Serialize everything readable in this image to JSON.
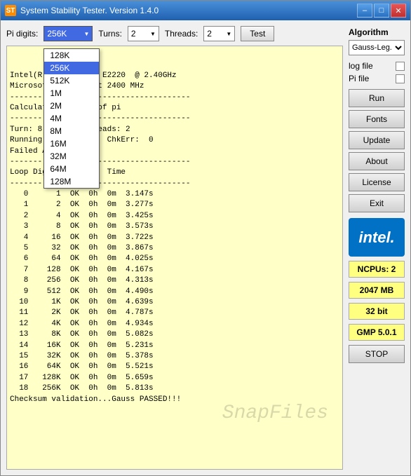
{
  "window": {
    "title": "System Stability Tester. Version 1.4.0",
    "icon": "ST"
  },
  "titleButtons": {
    "minimize": "–",
    "maximize": "□",
    "close": "✕"
  },
  "controls": {
    "piDigitsLabel": "Pi digits:",
    "piDigitsValue": "256K",
    "turnsLabel": "Turns:",
    "turnsValue": "2",
    "threadsLabel": "Threads:",
    "threadsValue": "2",
    "testButton": "Test"
  },
  "dropdown": {
    "options": [
      "128K",
      "256K",
      "512K",
      "1M",
      "2M",
      "4M",
      "8M",
      "16M",
      "32M",
      "64M",
      "128M"
    ],
    "selected": "256K"
  },
  "outputLines": [
    "Intel(R) Dual  CPU  E2220  @ 2.40GHz",
    "Microsoft Windows at 2400 MHz",
    "---------------------------------------",
    "Calculating digits of pi",
    "---------------------------------------",
    "Turn: 8         Threads: 2",
    "Running For: 2.969s  ChkErr:  0",
    "Failed After: 0 yet",
    "---------------------------------------",
    "Loop Digits  Status  Time",
    "---------------------------------------",
    "   0      1  OK  0h  0m  3.147s",
    "   1      2  OK  0h  0m  3.277s",
    "   2      4  OK  0h  0m  3.425s",
    "   3      8  OK  0h  0m  3.573s",
    "   4     16  OK  0h  0m  3.722s",
    "   5     32  OK  0h  0m  3.867s",
    "   6     64  OK  0h  0m  4.025s",
    "   7    128  OK  0h  0m  4.167s",
    "   8    256  OK  0h  0m  4.313s",
    "   9    512  OK  0h  0m  4.490s",
    "  10     1K  OK  0h  0m  4.639s",
    "  11     2K  OK  0h  0m  4.787s",
    "  12     4K  OK  0h  0m  4.934s",
    "  13     8K  OK  0h  0m  5.082s",
    "  14    16K  OK  0h  0m  5.231s",
    "  15    32K  OK  0h  0m  5.378s",
    "  16    64K  OK  0h  0m  5.521s",
    "  17   128K  OK  0h  0m  5.659s",
    "  18   256K  OK  0h  0m  5.813s",
    "Checksum validation...Gauss PASSED!!!"
  ],
  "sidebar": {
    "algorithmLabel": "Algorithm",
    "algorithmValue": "Gauss-Leg.",
    "logFileLabel": "log file",
    "piFileLabel": "Pi file",
    "buttons": {
      "run": "Run",
      "fonts": "Fonts",
      "update": "Update",
      "about": "About",
      "license": "License",
      "exit": "Exit",
      "stop": "STOP"
    },
    "intelText": "intel.",
    "badges": {
      "ncpus": "NCPUs: 2",
      "memory": "2047 MB",
      "bits": "32 bit",
      "gmp": "GMP 5.0.1"
    }
  },
  "watermark": "SnapFiles"
}
